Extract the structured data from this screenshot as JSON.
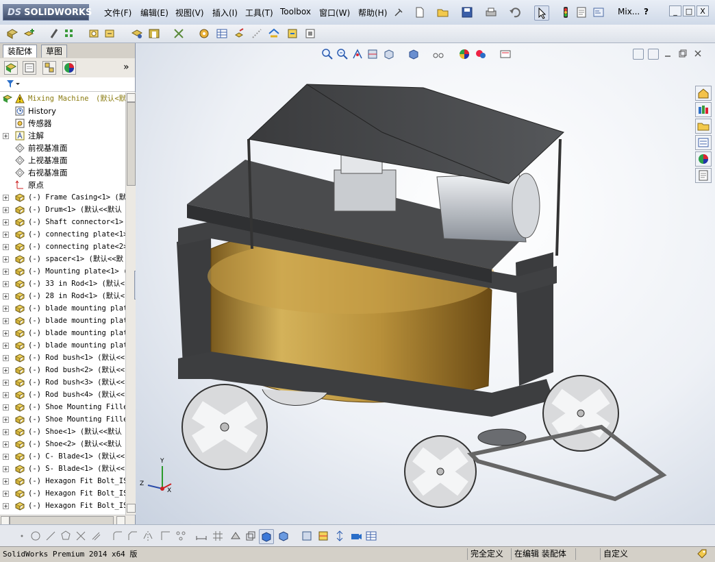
{
  "app": {
    "logo_text": "SOLIDWORKS",
    "logo_prefix": "DS"
  },
  "menu": [
    {
      "label": "文件(F)"
    },
    {
      "label": "编辑(E)"
    },
    {
      "label": "视图(V)"
    },
    {
      "label": "插入(I)"
    },
    {
      "label": "工具(T)"
    },
    {
      "label": "Toolbox"
    },
    {
      "label": "窗口(W)"
    },
    {
      "label": "帮助(H)"
    }
  ],
  "titlebar": {
    "doc_short": "Mix...",
    "help_glyph": "?"
  },
  "window_buttons": {
    "minimize": "_",
    "restore": "□",
    "close": "X"
  },
  "panel": {
    "tabs": [
      {
        "label": "装配体"
      },
      {
        "label": "草图"
      }
    ],
    "expand_glyph": "»",
    "root": {
      "name": "Mixing Machine",
      "suffix": "(默认<默"
    },
    "items": [
      {
        "label": "History",
        "icon": "history-icon",
        "plus": false
      },
      {
        "label": "传感器",
        "icon": "sensor-icon",
        "plus": false
      },
      {
        "label": "注解",
        "icon": "annotation-icon",
        "plus": true
      },
      {
        "label": "前视基准面",
        "icon": "plane-icon",
        "plus": false
      },
      {
        "label": "上视基准面",
        "icon": "plane-icon",
        "plus": false
      },
      {
        "label": "右视基准面",
        "icon": "plane-icon",
        "plus": false
      },
      {
        "label": "原点",
        "icon": "origin-icon",
        "plus": false
      },
      {
        "label": "(-) Frame Casing<1> (默认",
        "icon": "part-icon",
        "plus": true
      },
      {
        "label": "(-) Drum<1> (默认<<默认",
        "icon": "part-icon",
        "plus": true
      },
      {
        "label": "(-) Shaft connector<1>",
        "icon": "part-icon",
        "plus": true
      },
      {
        "label": "(-) connecting plate<1>",
        "icon": "part-icon",
        "plus": true
      },
      {
        "label": "(-) connecting plate<2>",
        "icon": "part-icon",
        "plus": true
      },
      {
        "label": "(-) spacer<1> (默认<<默",
        "icon": "part-icon",
        "plus": true
      },
      {
        "label": "(-) Mounting plate<1> (",
        "icon": "part-icon",
        "plus": true
      },
      {
        "label": "(-) 33 in Rod<1> (默认<",
        "icon": "part-icon",
        "plus": true
      },
      {
        "label": "(-) 28 in Rod<1> (默认<",
        "icon": "part-icon",
        "plus": true
      },
      {
        "label": "(-) blade mounting plat",
        "icon": "part-icon",
        "plus": true
      },
      {
        "label": "(-) blade mounting plat",
        "icon": "part-icon",
        "plus": true
      },
      {
        "label": "(-) blade mounting plat",
        "icon": "part-icon",
        "plus": true
      },
      {
        "label": "(-) blade mounting plat",
        "icon": "part-icon",
        "plus": true
      },
      {
        "label": "(-) Rod bush<1> (默认<<",
        "icon": "part-icon",
        "plus": true
      },
      {
        "label": "(-) Rod bush<2> (默认<<",
        "icon": "part-icon",
        "plus": true
      },
      {
        "label": "(-) Rod bush<3> (默认<<",
        "icon": "part-icon",
        "plus": true
      },
      {
        "label": "(-) Rod bush<4> (默认<<",
        "icon": "part-icon",
        "plus": true
      },
      {
        "label": "(-) Shoe Mounting Fille",
        "icon": "part-icon",
        "plus": true
      },
      {
        "label": "(-) Shoe Mounting Fille",
        "icon": "part-icon",
        "plus": true
      },
      {
        "label": "(-) Shoe<1> (默认<<默认",
        "icon": "part-icon",
        "plus": true
      },
      {
        "label": "(-) Shoe<2> (默认<<默认",
        "icon": "part-icon",
        "plus": true
      },
      {
        "label": "(-) C- Blade<1> (默认<<",
        "icon": "part-icon",
        "plus": true
      },
      {
        "label": "(-) S- Blade<1> (默认<<",
        "icon": "part-icon",
        "plus": true
      },
      {
        "label": "(-) Hexagon Fit Bolt_IS",
        "icon": "part-icon",
        "plus": true
      },
      {
        "label": "(-) Hexagon Fit Bolt_IS",
        "icon": "part-icon",
        "plus": true
      },
      {
        "label": "(-) Hexagon Fit Bolt_IS",
        "icon": "part-icon",
        "plus": true
      }
    ]
  },
  "triad": {
    "x": "X",
    "y": "Y",
    "z": "Z"
  },
  "status": {
    "product": "SolidWorks Premium 2014 x64 版",
    "definition": "完全定义",
    "editing": "在编辑 装配体",
    "units": "自定义"
  },
  "colors": {
    "drum": "#b58a3a",
    "frame": "#3f4042",
    "status_bg": "#d4d0c8",
    "panel_bg": "#ffffff"
  }
}
